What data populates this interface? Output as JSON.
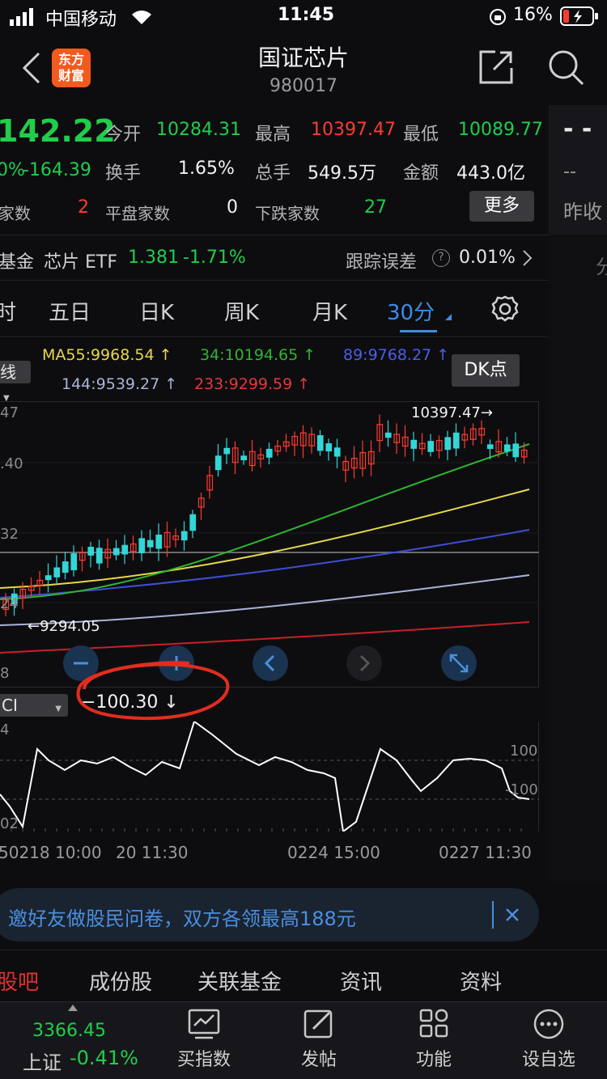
{
  "status_bar": {
    "carrier": "中国移动",
    "time": "11:45",
    "battery": "16%"
  },
  "header": {
    "title": "国证芯片",
    "code": "980017",
    "logo_line1": "东方",
    "logo_line2": "财富"
  },
  "quote": {
    "price": "142.22",
    "change_pct": "0%",
    "change_abs": "-164.39",
    "open_label": "今开",
    "open": "10284.31",
    "high_label": "最高",
    "high": "10397.47",
    "low_label": "最低",
    "low": "10089.77",
    "turnover_label": "换手",
    "turnover": "1.65%",
    "volume_label": "总手",
    "volume": "549.5万",
    "amount_label": "金额",
    "amount": "443.0亿",
    "up_count_label": "家数",
    "up_count": "2",
    "flat_label": "平盘家数",
    "flat_count": "0",
    "down_label": "下跌家数",
    "down_count": "27",
    "more": "更多",
    "side_dashes": "- -",
    "side_dash2": "--",
    "prev_close_label": "昨收"
  },
  "fund": {
    "label": "基金",
    "name": "芯片 ETF",
    "price": "1.381",
    "change": "-1.71%",
    "tracking_label": "跟踪误差",
    "tracking_value": "0.01%",
    "right_edge": "分"
  },
  "period_tabs": [
    "时",
    "五日",
    "日K",
    "周K",
    "月K",
    "30分"
  ],
  "active_period": "30分",
  "ma_legend": {
    "selector": "线",
    "ma55": "MA55:9968.54 ↑",
    "ma34": "34:10194.65 ↑",
    "ma89": "89:9768.27 ↑",
    "ma144": "144:9539.27 ↑",
    "ma233": "233:9299.59 ↑",
    "dk_button": "DK点"
  },
  "chart_data": {
    "type": "candlestick",
    "y_tick_labels": [
      "47",
      ".40",
      "32",
      "24",
      "8"
    ],
    "high_marker": "10397.47→",
    "low_marker": "←9294.05",
    "x_tick_labels": [
      "50218 10:00",
      "20 11:30",
      "0224 15:00",
      "0227 11:30"
    ],
    "ma_colors": {
      "ma34": "#2fb52f",
      "ma55": "#e8d84a",
      "ma89": "#3d4fd6",
      "ma144": "#a9b4d8",
      "ma233": "#c8202a"
    },
    "up_color": "#ff3b30",
    "down_color": "#33d6d6"
  },
  "cci": {
    "selector": "CI",
    "value": "−100.30 ↓",
    "top_label": "4",
    "bottom_label": "02",
    "level_high": "100",
    "level_low": "-100"
  },
  "banner": {
    "text": "邀好友做股民问卷，双方各领最高188元"
  },
  "bottom_tabs": [
    "股吧",
    "成份股",
    "关联基金",
    "资讯",
    "资料"
  ],
  "nav": {
    "index_value": "3366.45",
    "index_name": "上证",
    "index_change": "-0.41%",
    "buy": "买指数",
    "post": "发帖",
    "func": "功能",
    "custom": "设自选"
  }
}
